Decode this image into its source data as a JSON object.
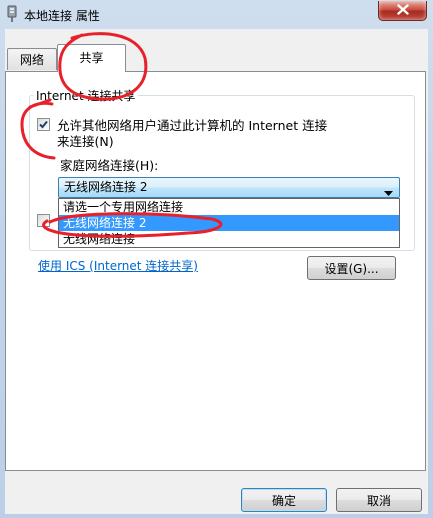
{
  "window": {
    "title": "本地连接 属性"
  },
  "tabs": [
    {
      "label": "网络",
      "selected": false
    },
    {
      "label": "共享",
      "selected": true
    }
  ],
  "sharing": {
    "group_title": "Internet 连接共享",
    "allow_others_connect": {
      "label_line1": "允许其他网络用户通过此计算机的 Internet 连接",
      "label_line2": "来连接(N)",
      "checked": true
    },
    "second_checkbox": {
      "checked": false
    },
    "home_network_label": "家庭网络连接(H):",
    "home_network_select": {
      "value": "无线网络连接 2",
      "options": [
        "请选一个专用网络连接",
        "无线网络连接 2",
        "无线网络连接"
      ],
      "highlighted_index": 1
    },
    "ics_link": "使用 ICS (Internet 连接共享)",
    "settings_button": "设置(G)..."
  },
  "footer": {
    "ok_button": "确定",
    "cancel_button": "取消"
  },
  "icons": {
    "title": "network-connection-icon",
    "close": "close-icon",
    "dropdown": "chevron-down-icon",
    "check": "checkmark-icon"
  },
  "colors": {
    "highlight": "#3399ff",
    "link": "#0066cc",
    "annotation": "#e8202a",
    "close_button": "#c9463d"
  }
}
